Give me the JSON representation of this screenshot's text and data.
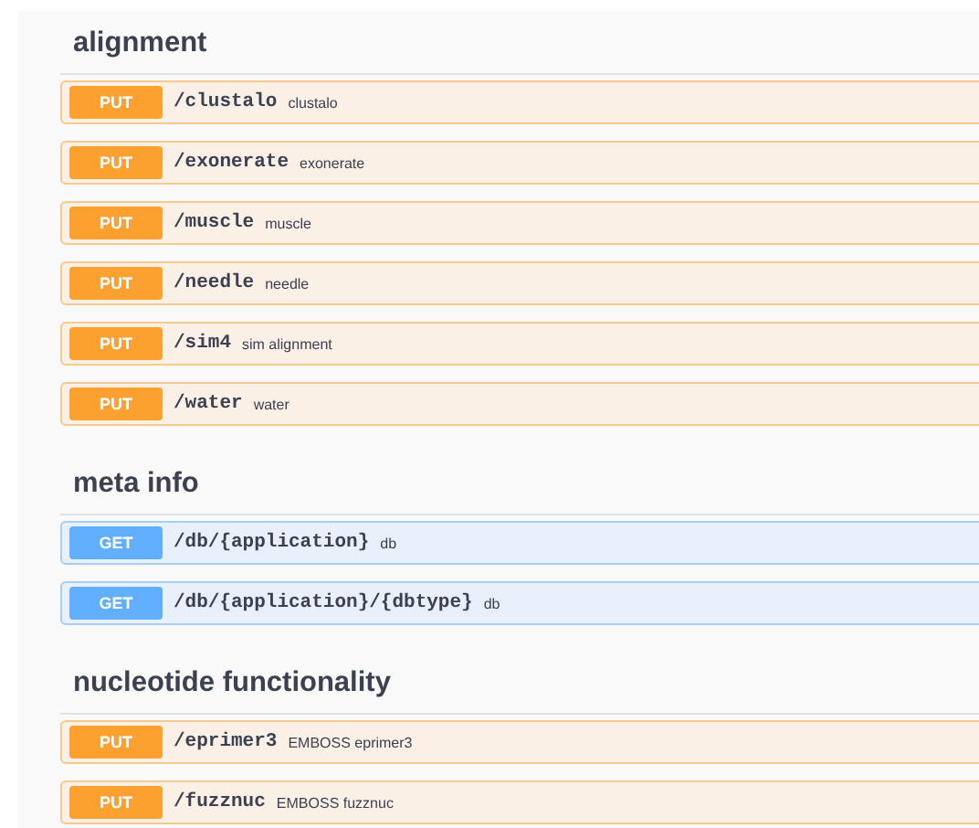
{
  "sections": [
    {
      "title": "alignment",
      "operations": [
        {
          "method": "PUT",
          "path": "/clustalo",
          "summary": "clustalo"
        },
        {
          "method": "PUT",
          "path": "/exonerate",
          "summary": "exonerate"
        },
        {
          "method": "PUT",
          "path": "/muscle",
          "summary": "muscle"
        },
        {
          "method": "PUT",
          "path": "/needle",
          "summary": "needle"
        },
        {
          "method": "PUT",
          "path": "/sim4",
          "summary": "sim alignment"
        },
        {
          "method": "PUT",
          "path": "/water",
          "summary": "water"
        }
      ]
    },
    {
      "title": "meta info",
      "operations": [
        {
          "method": "GET",
          "path": "/db/{application}",
          "summary": "db"
        },
        {
          "method": "GET",
          "path": "/db/{application}/{dbtype}",
          "summary": "db"
        }
      ]
    },
    {
      "title": "nucleotide functionality",
      "operations": [
        {
          "method": "PUT",
          "path": "/eprimer3",
          "summary": "EMBOSS eprimer3"
        },
        {
          "method": "PUT",
          "path": "/fuzznuc",
          "summary": "EMBOSS fuzznuc"
        }
      ]
    }
  ]
}
